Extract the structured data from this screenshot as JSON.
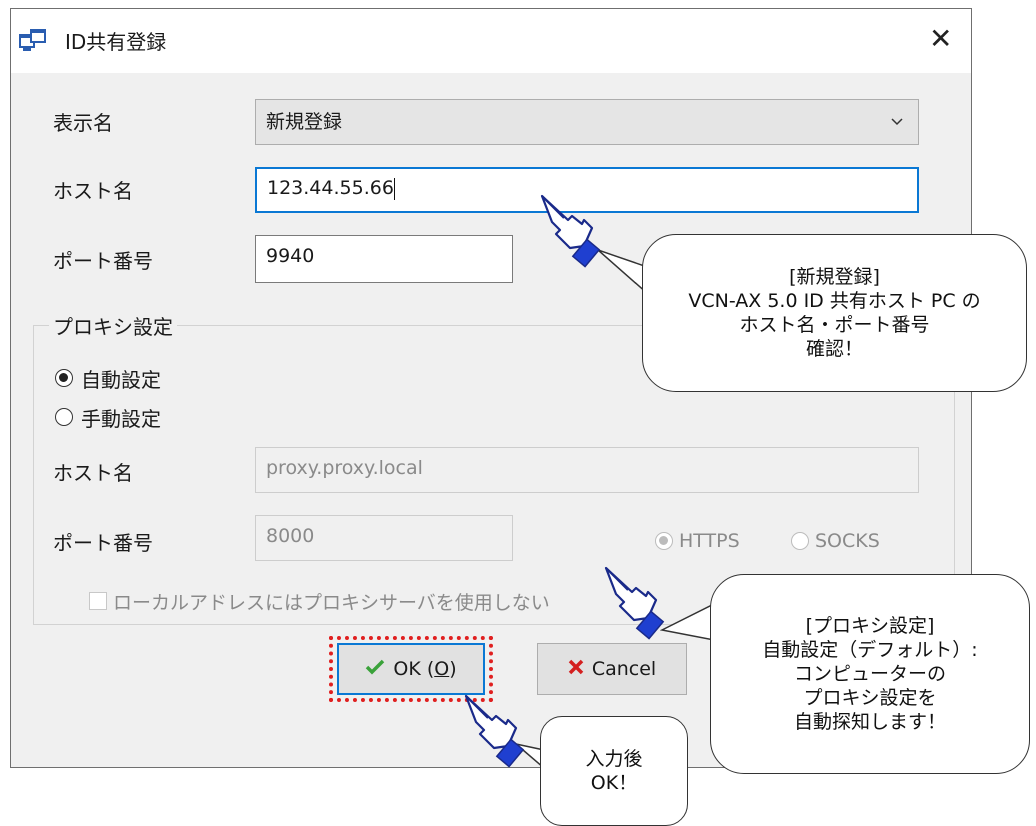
{
  "window": {
    "title": "ID共有登録",
    "close": "✕"
  },
  "form": {
    "display_name_label": "表示名",
    "display_name_value": "新規登録",
    "host_label": "ホスト名",
    "host_value": "123.44.55.66",
    "port_label": "ポート番号",
    "port_value": "9940"
  },
  "proxy": {
    "group_label": "プロキシ設定",
    "auto_label": "自動設定",
    "manual_label": "手動設定",
    "selected": "auto",
    "host_label": "ホスト名",
    "host_value": "proxy.proxy.local",
    "port_label": "ポート番号",
    "port_value": "8000",
    "https_label": "HTTPS",
    "socks_label": "SOCKS",
    "protocol_selected": "HTTPS",
    "bypass_local_label": "ローカルアドレスにはプロキシサーバを使用しない",
    "bypass_local_checked": false
  },
  "buttons": {
    "ok_label": "OK (O)",
    "ok_text": "OK (",
    "ok_mnemonic": "O",
    "ok_close": ")",
    "cancel_label": "Cancel"
  },
  "callouts": {
    "new_registration": {
      "line1": "[新規登録]",
      "line2": "VCN-AX 5.0 ID 共有ホスト PC の",
      "line3": "ホスト名・ポート番号",
      "line4": "確認！"
    },
    "proxy_setting": {
      "line1": "[プロキシ設定]",
      "line2": "自動設定（デフォルト）:",
      "line3": "コンピューターの",
      "line4": "プロキシ設定を",
      "line5": "自動探知します！"
    },
    "after_input": {
      "line1": "入力後",
      "line2": "OK！"
    }
  },
  "colors": {
    "accent": "#0a78d4",
    "highlight": "#e02020",
    "dialog_bg": "#f0f0f0",
    "ok_check": "#3aa23a",
    "cancel_x": "#d42020"
  }
}
